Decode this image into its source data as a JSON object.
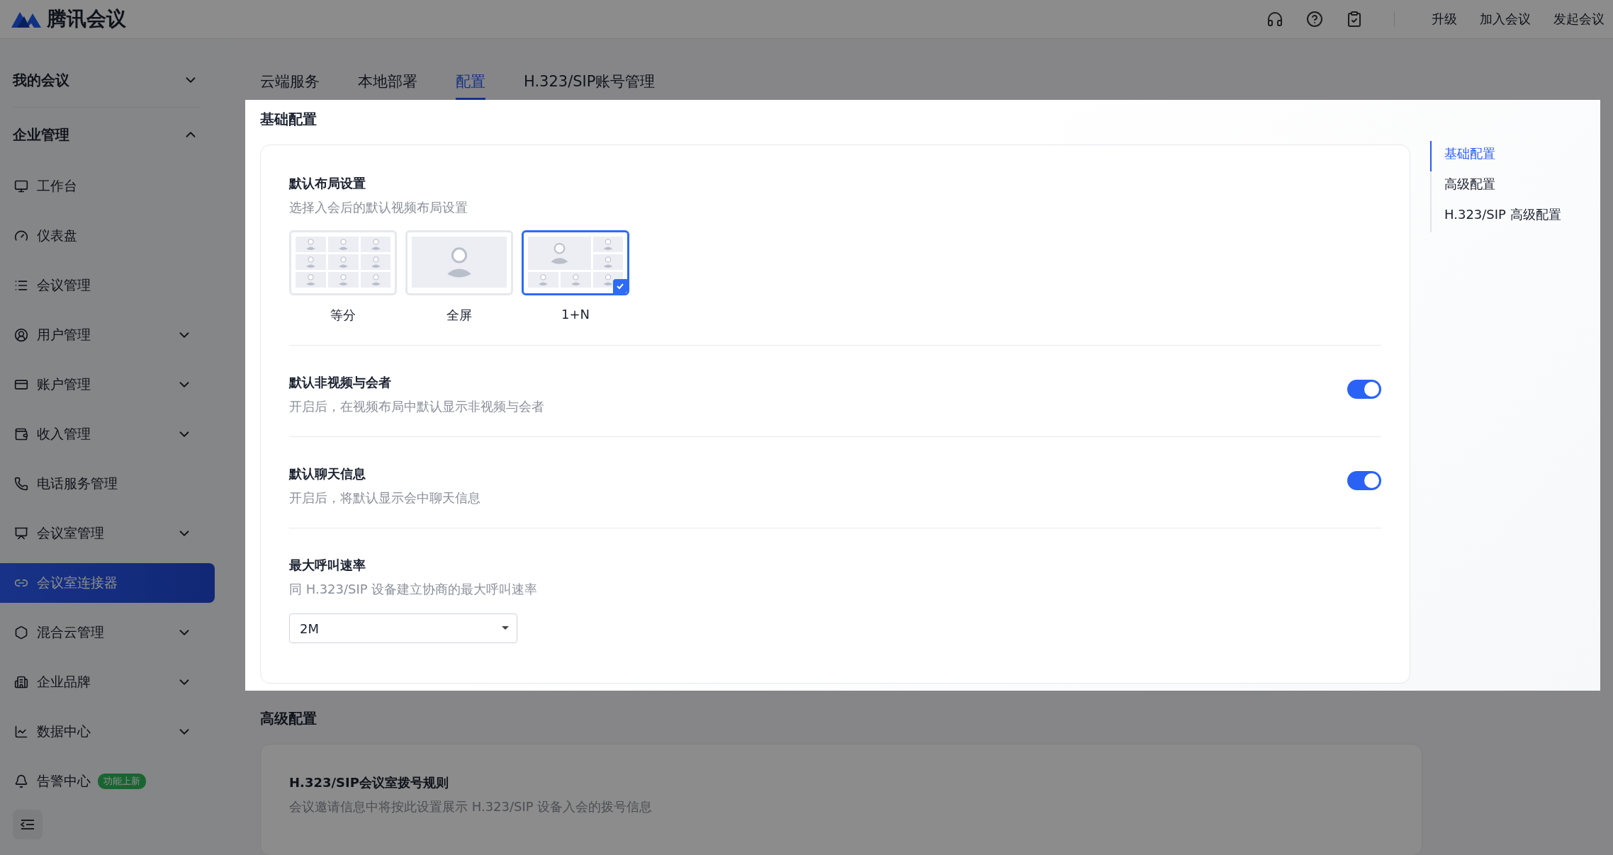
{
  "header": {
    "logo_text": "腾讯会议",
    "actions": [
      {
        "label": "升级"
      },
      {
        "label": "加入会议"
      },
      {
        "label": "发起会议"
      }
    ]
  },
  "sidebar": {
    "sections": [
      {
        "label": "我的会议",
        "expanded": false
      },
      {
        "label": "企业管理",
        "expanded": true,
        "items": [
          {
            "label": "工作台",
            "kind": "link",
            "selected": false
          },
          {
            "label": "仪表盘",
            "kind": "link",
            "selected": false
          },
          {
            "label": "会议管理",
            "kind": "link",
            "selected": false
          },
          {
            "label": "用户管理",
            "kind": "submenu",
            "selected": false
          },
          {
            "label": "账户管理",
            "kind": "submenu",
            "selected": false
          },
          {
            "label": "收入管理",
            "kind": "submenu",
            "selected": false
          },
          {
            "label": "电话服务管理",
            "kind": "link",
            "selected": false
          },
          {
            "label": "会议室管理",
            "kind": "submenu",
            "selected": false
          },
          {
            "label": "会议室连接器",
            "kind": "link",
            "selected": true
          },
          {
            "label": "混合云管理",
            "kind": "submenu",
            "selected": false
          },
          {
            "label": "企业品牌",
            "kind": "submenu",
            "selected": false
          },
          {
            "label": "数据中心",
            "kind": "submenu",
            "selected": false
          },
          {
            "label": "告警中心",
            "kind": "link",
            "selected": false,
            "badge": "功能上新"
          }
        ]
      }
    ]
  },
  "tabs": [
    {
      "label": "云端服务",
      "selected": false
    },
    {
      "label": "本地部署",
      "selected": false
    },
    {
      "label": "配置",
      "selected": true
    },
    {
      "label": "H.323/SIP账号管理",
      "selected": false
    }
  ],
  "basic_section": {
    "title": "基础配置",
    "highlighted": true,
    "settings": [
      {
        "kind": "layout",
        "title": "默认布局设置",
        "description": "选择入会后的默认视频布局设置",
        "options": [
          {
            "kind": "grid",
            "label": "等分",
            "selected": false
          },
          {
            "kind": "full",
            "label": "全屏",
            "selected": false
          },
          {
            "kind": "one_plus_n",
            "label": "1+N",
            "selected": true
          }
        ]
      },
      {
        "kind": "toggle",
        "title": "默认非视频与会者",
        "description": "开启后，在视频布局中默认显示非视频与会者",
        "on": true
      },
      {
        "kind": "toggle",
        "title": "默认聊天信息",
        "description": "开启后，将默认显示会中聊天信息",
        "on": true
      },
      {
        "kind": "select",
        "title": "最大呼叫速率",
        "description": "同 H.323/SIP 设备建立协商的最大呼叫速率",
        "value": "2M"
      }
    ]
  },
  "anchor_nav": [
    {
      "label": "基础配置",
      "selected": true
    },
    {
      "label": "高级配置",
      "selected": false
    },
    {
      "label": "H.323/SIP 高级配置",
      "selected": false
    }
  ],
  "advanced_section": {
    "title": "高级配置",
    "settings": [
      {
        "title": "H.323/SIP会议室拨号规则",
        "description": "会议邀请信息中将按此设置展示 H.323/SIP 设备入会的拨号信息"
      }
    ]
  }
}
